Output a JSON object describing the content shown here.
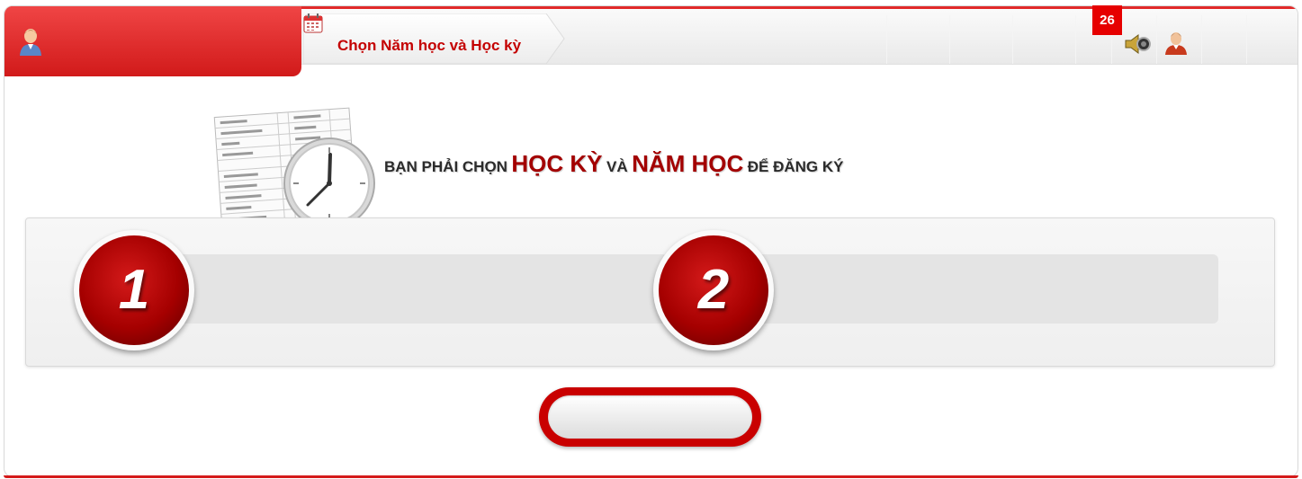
{
  "header": {
    "tab_label": "Chọn Năm học và Học kỳ",
    "notification_count": "26",
    "accent_color": "#e12a2a",
    "icons": [
      "user-icon",
      "calendar-icon",
      "speaker-icon",
      "profile-icon"
    ]
  },
  "main": {
    "heading": {
      "part1": "BẠN PHẢI CHỌN",
      "part2": "HỌC KỲ",
      "part3": "VÀ",
      "part4": "NĂM HỌC",
      "part5": "ĐỂ ĐĂNG KÝ"
    },
    "steps": [
      {
        "number": "1",
        "value": ""
      },
      {
        "number": "2",
        "value": ""
      }
    ],
    "confirm_button_label": ""
  }
}
